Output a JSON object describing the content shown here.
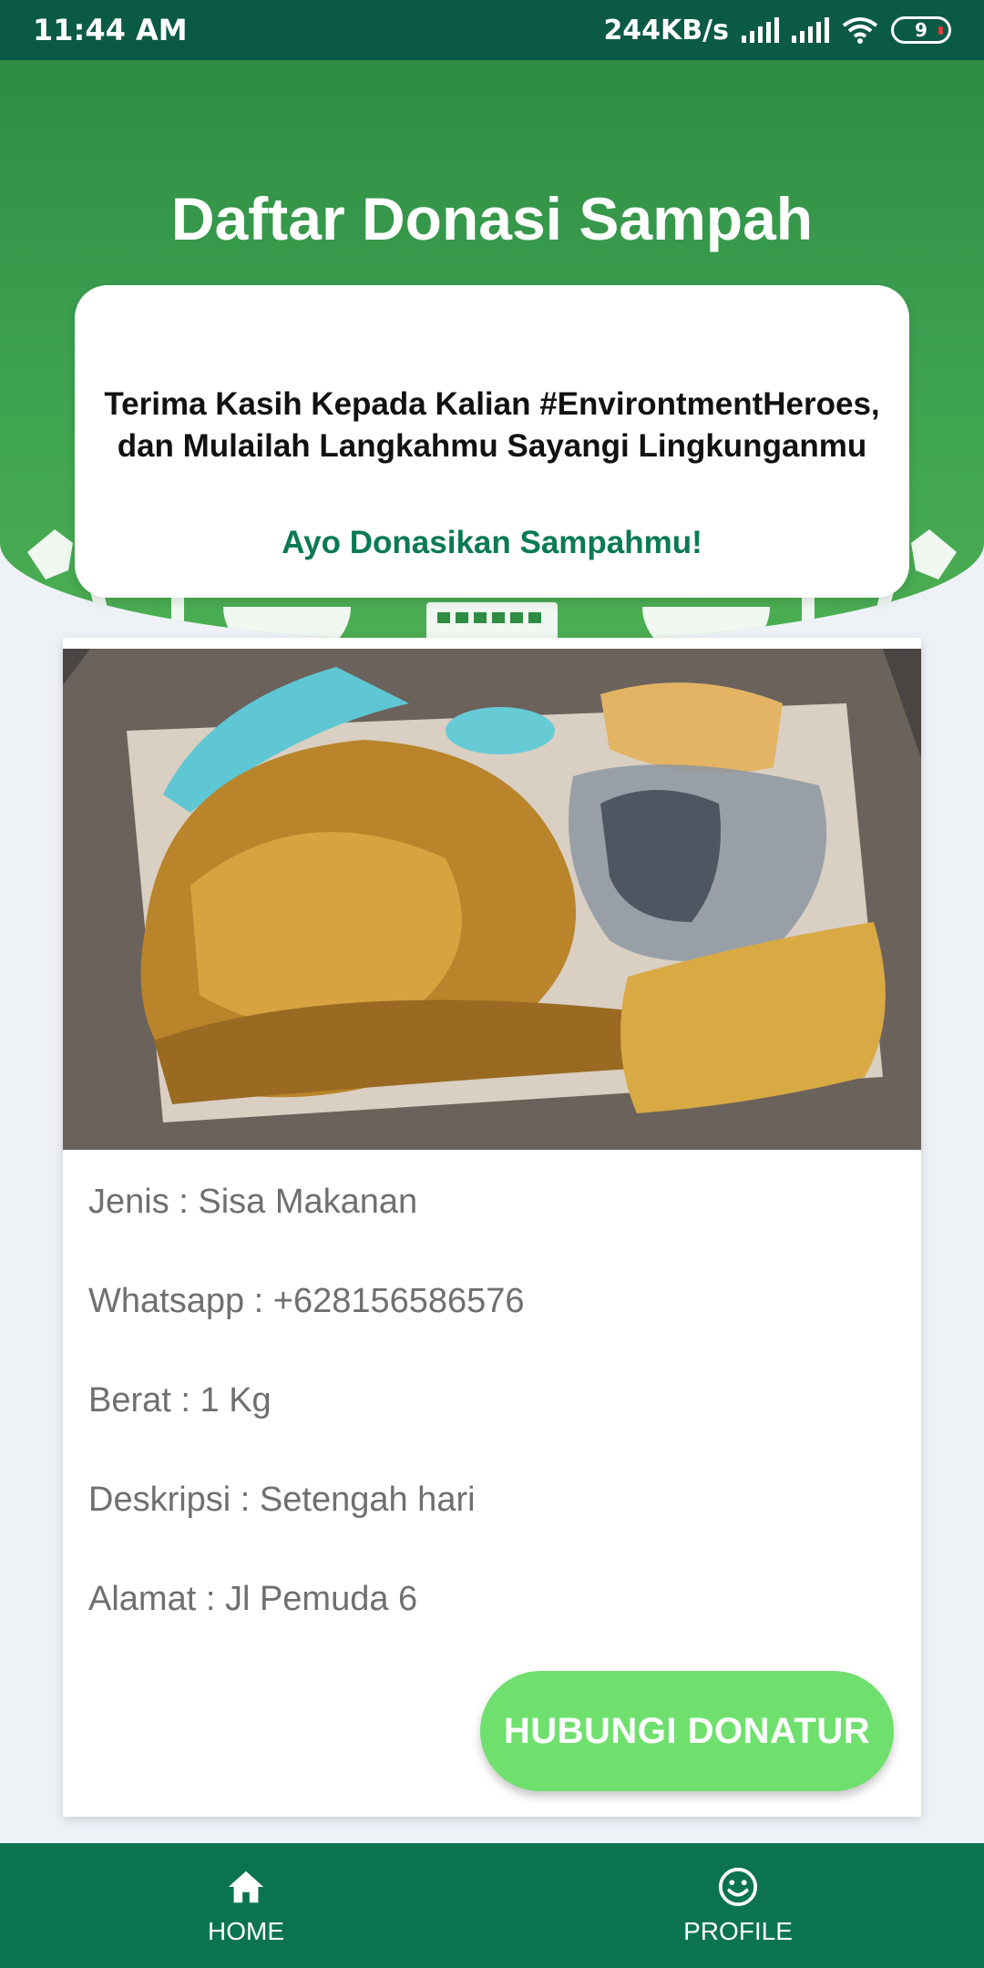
{
  "status_bar": {
    "time": "11:44 AM",
    "network_speed": "244KB/s",
    "battery_level": "9"
  },
  "header": {
    "title": "Daftar Donasi Sampah"
  },
  "info_card": {
    "message": "Terima Kasih Kepada Kalian #EnvirontmentHeroes,\ndan Mulailah Langkahmu Sayangi Lingkunganmu",
    "cta": "Ayo Donasikan Sampahmu!"
  },
  "donation": {
    "jenis": "Jenis : Sisa Makanan",
    "whatsapp": "Whatsapp : +628156586576",
    "berat": "Berat : 1 Kg",
    "deskripsi": "Deskripsi : Setengah hari",
    "alamat": "Alamat : Jl Pemuda 6",
    "button_label": "HUBUNGI DONATUR"
  },
  "bottom_nav": {
    "items": [
      {
        "label": "HOME",
        "icon": "home-icon"
      },
      {
        "label": "PROFILE",
        "icon": "smiley-icon"
      }
    ]
  },
  "colors": {
    "status_bar": "#0a5a44",
    "header_green": "#3da351",
    "accent_text": "#0b7a52",
    "button_green": "#6fe06e",
    "nav_bar": "#0b7350"
  }
}
